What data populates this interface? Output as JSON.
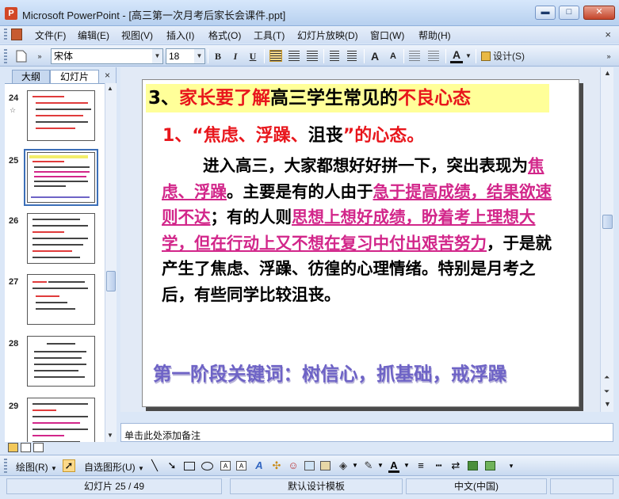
{
  "window": {
    "title": "Microsoft PowerPoint - [高三第一次月考后家长会课件.ppt]",
    "min": "▬",
    "max": "□",
    "close": "✕"
  },
  "menu": {
    "items": [
      "文件(F)",
      "编辑(E)",
      "视图(V)",
      "插入(I)",
      "格式(O)",
      "工具(T)",
      "幻灯片放映(D)",
      "窗口(W)",
      "帮助(H)"
    ],
    "close_glyph": "×"
  },
  "toolbar": {
    "font_name": "宋体",
    "font_size": "18",
    "bold": "B",
    "italic": "I",
    "underline": "U",
    "grow_font": "A",
    "shrink_font": "A",
    "font_color": "A",
    "design_label": "设计(S)"
  },
  "left_pane": {
    "tabs": [
      "大纲",
      "幻灯片"
    ],
    "close_glyph": "×",
    "slide_numbers": [
      "24",
      "25",
      "26",
      "27",
      "28",
      "29"
    ],
    "selected": "25"
  },
  "slide": {
    "heading_prefix": "3、",
    "heading_red1": "家长要了解",
    "heading_mid": "高三学生常见的",
    "heading_red2": "不良心态",
    "sub_red1": "1、“焦虑、浮躁、",
    "sub_black": "沮丧",
    "sub_red2": "”的心态。",
    "body_1": "进入高三，大家都想好好拼一下，突出表现为",
    "body_hl1": "焦虑、浮躁",
    "body_2": "。主要是有的人由于",
    "body_hl2": "急于提高成绩，结果欲速则不达",
    "body_3": "；有的人则",
    "body_hl3": "思想上想好成绩，盼着考上理想大学，但在行动上又不想在复习中付出艰苦努力",
    "body_4": "，于是就产生了焦虑、浮躁、彷徨的心理情绪。特别是月考之后，有些同学比较沮丧。",
    "keywords": "第一阶段关键词：树信心，抓基础，戒浮躁"
  },
  "notes": {
    "placeholder": "单击此处添加备注"
  },
  "drawing_toolbar": {
    "draw_label": "绘图(R)",
    "autoshapes_label": "自选图形(U)"
  },
  "status": {
    "slide_pos": "幻灯片 25 / 49",
    "template": "默认设计模板",
    "language": "中文(中国)"
  },
  "colors": {
    "heading_bg": "#ffff99",
    "red": "#e8161c",
    "highlight": "#d2268a",
    "keywords": "#6e63c6"
  }
}
